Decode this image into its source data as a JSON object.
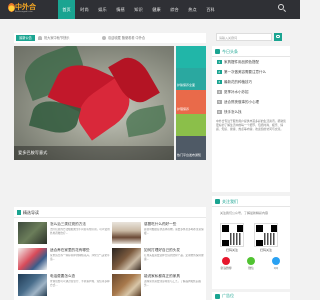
{
  "site": {
    "name": "中外合",
    "tagline": "Rmzhongwai.com"
  },
  "nav": {
    "items": [
      "首页",
      "时尚",
      "娱乐",
      "情感",
      "知识",
      "健康",
      "综合",
      "热点",
      "百科"
    ],
    "active": 0
  },
  "notice": {
    "tag": "最新公告",
    "text1": "祝大家中秋节快乐",
    "text2": "欢迎收藏 随便看看 中外合"
  },
  "hero": {
    "caption": "爱多巴胺写意式"
  },
  "tiles": [
    {
      "label": ""
    },
    {
      "label": "护肤保养全面"
    },
    {
      "label": "护理保养"
    },
    {
      "label": ""
    },
    {
      "label": "热门平台发布通知"
    }
  ],
  "sidebar": {
    "search_placeholder": "请输入关键词",
    "ranking_title": "今日头条",
    "ranking": [
      {
        "num": "1",
        "title": "家具摆件用品颜色搭配"
      },
      {
        "num": "2",
        "title": "第一次做美容需要注意什么"
      },
      {
        "num": "3",
        "title": "最新花的种植技巧"
      },
      {
        "num": "4",
        "title": "夏季补水小妙招"
      },
      {
        "num": "5",
        "title": "适合熬夜做事的小心理"
      },
      {
        "num": "6",
        "title": "快手怎么找"
      }
    ],
    "para": "中外合专注于服务用户提供丰富多彩的生活资讯，帮助您更好的了解生活中的每一个细节，包括时尚、娱乐、情感、知识、健康、热点等内容，欢迎您的访问与交流。",
    "follow_title": "关注我们",
    "follow_desc": "关注我们公众号，了解最新精彩内容",
    "qr_labels": [
      "扫码关注",
      "扫码关注"
    ],
    "share": [
      {
        "label": "新浪微博",
        "color": "#e6162d"
      },
      {
        "label": "微信",
        "color": "#51c332"
      },
      {
        "label": "QQ",
        "color": "#2aa1f2"
      }
    ],
    "bottom_title": "广告位"
  },
  "section": {
    "title": "精选导读",
    "articles": [
      {
        "title": "怎么治三类红斑的方法",
        "desc": "治疗红斑的方法根据类型不同而有所区别，可以使用外用药物治疗..."
      },
      {
        "title": "感冒吃什么药好一些",
        "desc": "感冒时根据症状选择药物，需要多休息多喝水注意保暖..."
      },
      {
        "title": "适合养在家里的花有哪些",
        "desc": "家里适合养一些好养护的绿植花卉，净化空气美化环境..."
      },
      {
        "title": "如何打理好自己的头发",
        "desc": "打理头发需要选择合适的洗护产品，定期修剪保持健康..."
      },
      {
        "title": "电话费要怎么查",
        "desc": "查询话费可以通过营业厅、手机客户端、短信等多种方式..."
      },
      {
        "title": "能说家私都真正的家具",
        "desc": "选购家具需要注意材质与工艺，了解品牌和售后服务..."
      }
    ]
  }
}
